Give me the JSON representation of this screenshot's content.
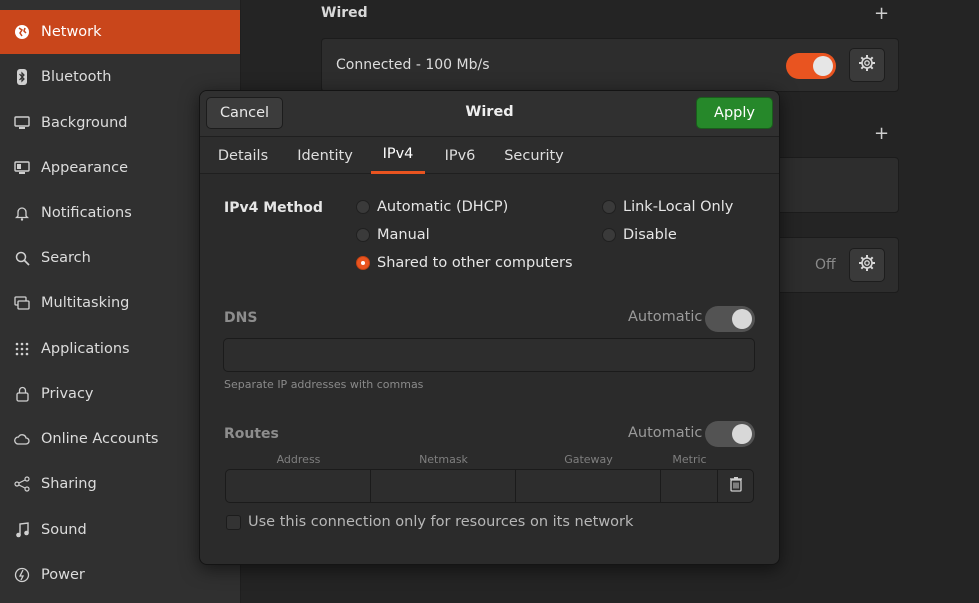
{
  "sidebar": {
    "items": [
      {
        "label": "Network",
        "icon": "globe-icon",
        "active": true
      },
      {
        "label": "Bluetooth",
        "icon": "bluetooth-icon"
      },
      {
        "label": "Background",
        "icon": "monitor-icon"
      },
      {
        "label": "Appearance",
        "icon": "appearance-icon"
      },
      {
        "label": "Notifications",
        "icon": "bell-icon"
      },
      {
        "label": "Search",
        "icon": "search-icon"
      },
      {
        "label": "Multitasking",
        "icon": "multitasking-icon"
      },
      {
        "label": "Applications",
        "icon": "grid-icon"
      },
      {
        "label": "Privacy",
        "icon": "lock-icon"
      },
      {
        "label": "Online Accounts",
        "icon": "cloud-icon"
      },
      {
        "label": "Sharing",
        "icon": "share-icon"
      },
      {
        "label": "Sound",
        "icon": "music-note-icon"
      },
      {
        "label": "Power",
        "icon": "power-icon"
      }
    ]
  },
  "network": {
    "wired_heading": "Wired",
    "wired_status": "Connected - 100 Mb/s",
    "wired_enabled": true,
    "second_status": "Off"
  },
  "dialog": {
    "title": "Wired",
    "cancel_label": "Cancel",
    "apply_label": "Apply",
    "tabs": [
      {
        "label": "Details"
      },
      {
        "label": "Identity"
      },
      {
        "label": "IPv4",
        "active": true
      },
      {
        "label": "IPv6"
      },
      {
        "label": "Security"
      }
    ],
    "ipv4_method_label": "IPv4 Method",
    "methods": {
      "auto": "Automatic (DHCP)",
      "manual": "Manual",
      "shared": "Shared to other computers",
      "link_local": "Link-Local Only",
      "disable": "Disable"
    },
    "selected_method": "Shared to other computers",
    "dns_label": "DNS",
    "dns_automatic_label": "Automatic",
    "dns_value": "",
    "dns_hint": "Separate IP addresses with commas",
    "routes_label": "Routes",
    "routes_automatic_label": "Automatic",
    "route_columns": [
      "Address",
      "Netmask",
      "Gateway",
      "Metric"
    ],
    "only_resources_label": "Use this connection only for resources on its network"
  },
  "colors": {
    "accent": "#e95420",
    "apply_green": "#26882a",
    "sidebar_active": "#c9461b"
  }
}
